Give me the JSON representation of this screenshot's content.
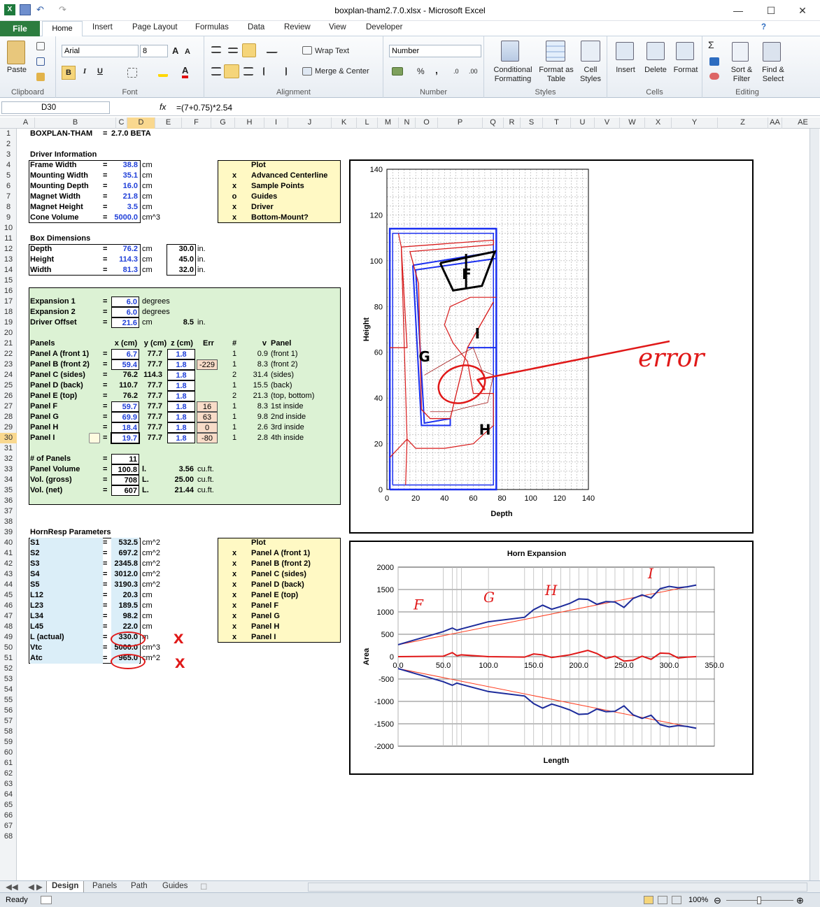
{
  "window": {
    "title": "boxplan-tham2.7.0.xlsx  -  Microsoft Excel"
  },
  "tabs": [
    "File",
    "Home",
    "Insert",
    "Page Layout",
    "Formulas",
    "Data",
    "Review",
    "View",
    "Developer"
  ],
  "ribbon": {
    "clipboard": {
      "paste": "Paste",
      "label": "Clipboard"
    },
    "font": {
      "name": "Arial",
      "size": "8",
      "label": "Font",
      "bold": "B",
      "italic": "I",
      "underline": "U"
    },
    "alignment": {
      "wrap": "Wrap Text",
      "merge": "Merge & Center",
      "label": "Alignment"
    },
    "number": {
      "format": "Number",
      "label": "Number",
      "percent": "%",
      "comma": ","
    },
    "styles": {
      "conditional": "Conditional Formatting",
      "table": "Format as Table",
      "cell": "Cell Styles",
      "label": "Styles"
    },
    "cells": {
      "insert": "Insert",
      "delete": "Delete",
      "format": "Format",
      "label": "Cells"
    },
    "editing": {
      "sort": "Sort & Filter",
      "find": "Find & Select",
      "label": "Editing"
    }
  },
  "formula_bar": {
    "name_box": "D30",
    "fx": "fx",
    "formula": "=(7+0.75)*2.54"
  },
  "columns": [
    "A",
    "B",
    "C",
    "D",
    "E",
    "F",
    "G",
    "H",
    "I",
    "J",
    "K",
    "L",
    "M",
    "N",
    "O",
    "P",
    "Q",
    "R",
    "S",
    "T",
    "U",
    "V",
    "W",
    "X",
    "Y",
    "Z",
    "AA",
    "AE"
  ],
  "sheet": {
    "title": "BOXPLAN-THAM",
    "eq": "=",
    "version": "2.7.0 BETA",
    "driver_header": "Driver Information",
    "driver": [
      {
        "label": "Frame Width",
        "value": "38.8",
        "unit": "cm"
      },
      {
        "label": "Mounting Width",
        "value": "35.1",
        "unit": "cm"
      },
      {
        "label": "Mounting Depth",
        "value": "16.0",
        "unit": "cm"
      },
      {
        "label": "Magnet Width",
        "value": "21.8",
        "unit": "cm"
      },
      {
        "label": "Magnet Height",
        "value": "3.5",
        "unit": "cm"
      },
      {
        "label": "Cone Volume",
        "value": "5000.0",
        "unit": "cm^3"
      }
    ],
    "plot1_header": "Plot",
    "plot1": [
      {
        "mark": "x",
        "label": "Advanced Centerline"
      },
      {
        "mark": "x",
        "label": "Sample Points"
      },
      {
        "mark": "o",
        "label": "Guides"
      },
      {
        "mark": "x",
        "label": "Driver"
      },
      {
        "mark": "x",
        "label": "Bottom-Mount?"
      }
    ],
    "box_header": "Box Dimensions",
    "box": [
      {
        "label": "Depth",
        "value": "76.2",
        "unit": "cm",
        "in": "30.0",
        "in_unit": "in."
      },
      {
        "label": "Height",
        "value": "114.3",
        "unit": "cm",
        "in": "45.0",
        "in_unit": "in."
      },
      {
        "label": "Width",
        "value": "81.3",
        "unit": "cm",
        "in": "32.0",
        "in_unit": "in."
      }
    ],
    "expansion": [
      {
        "label": "Expansion 1",
        "value": "6.0",
        "unit": "degrees"
      },
      {
        "label": "Expansion 2",
        "value": "6.0",
        "unit": "degrees"
      },
      {
        "label": "Driver Offset",
        "value": "21.6",
        "unit": "cm",
        "extra": "8.5",
        "extra_unit": "in."
      }
    ],
    "panel_headers": {
      "panels": "Panels",
      "x": "x (cm)",
      "y": "y (cm)",
      "z": "z (cm)",
      "err": "Err",
      "num": "#",
      "v": "v",
      "panel": "Panel"
    },
    "panels": [
      {
        "label": "Panel A (front 1)",
        "x": "6.7",
        "y": "77.7",
        "z": "1.8",
        "err": "",
        "num": "1",
        "v": "0.9",
        "name": "(front 1)",
        "xin": true
      },
      {
        "label": "Panel B (front 2)",
        "x": "59.4",
        "y": "77.7",
        "z": "1.8",
        "err": "-229",
        "num": "1",
        "v": "8.3",
        "name": "(front 2)",
        "xin": true
      },
      {
        "label": "Panel C (sides)",
        "x": "76.2",
        "y": "114.3",
        "z": "1.8",
        "err": "",
        "num": "2",
        "v": "31.4",
        "name": "(sides)",
        "xin": false
      },
      {
        "label": "Panel D (back)",
        "x": "110.7",
        "y": "77.7",
        "z": "1.8",
        "err": "",
        "num": "1",
        "v": "15.5",
        "name": "(back)",
        "xin": false
      },
      {
        "label": "Panel E (top)",
        "x": "76.2",
        "y": "77.7",
        "z": "1.8",
        "err": "",
        "num": "2",
        "v": "21.3",
        "name": "(top, bottom)",
        "xin": false
      },
      {
        "label": "Panel F",
        "x": "59.7",
        "y": "77.7",
        "z": "1.8",
        "err": "16",
        "num": "1",
        "v": "8.3",
        "name": "1st inside",
        "xin": true
      },
      {
        "label": "Panel G",
        "x": "69.9",
        "y": "77.7",
        "z": "1.8",
        "err": "63",
        "num": "1",
        "v": "9.8",
        "name": "2nd inside",
        "xin": true
      },
      {
        "label": "Panel H",
        "x": "18.4",
        "y": "77.7",
        "z": "1.8",
        "err": "0",
        "num": "1",
        "v": "2.6",
        "name": "3rd inside",
        "xin": true
      },
      {
        "label": "Panel I",
        "x": "19.7",
        "y": "77.7",
        "z": "1.8",
        "err": "-80",
        "num": "1",
        "v": "2.8",
        "name": "4th inside",
        "xin": true
      }
    ],
    "totals": [
      {
        "label": "# of Panels",
        "value": "11",
        "unit": "",
        "extra": "",
        "extra_unit": ""
      },
      {
        "label": "Panel Volume",
        "value": "100.8",
        "unit": "l.",
        "extra": "3.56",
        "extra_unit": "cu.ft."
      },
      {
        "label": "Vol. (gross)",
        "value": "708",
        "unit": "L.",
        "extra": "25.00",
        "extra_unit": "cu.ft."
      },
      {
        "label": "Vol. (net)",
        "value": "607",
        "unit": "L.",
        "extra": "21.44",
        "extra_unit": "cu.ft."
      }
    ],
    "hornresp_header": "HornResp Parameters",
    "hornresp": [
      {
        "label": "S1",
        "value": "532.5",
        "unit": "cm^2"
      },
      {
        "label": "S2",
        "value": "697.2",
        "unit": "cm^2"
      },
      {
        "label": "S3",
        "value": "2345.8",
        "unit": "cm^2"
      },
      {
        "label": "S4",
        "value": "3012.0",
        "unit": "cm^2"
      },
      {
        "label": "S5",
        "value": "3190.3",
        "unit": "cm^2"
      },
      {
        "label": "L12",
        "value": "20.3",
        "unit": "cm"
      },
      {
        "label": "L23",
        "value": "189.5",
        "unit": "cm"
      },
      {
        "label": "L34",
        "value": "98.2",
        "unit": "cm"
      },
      {
        "label": "L45",
        "value": "22.0",
        "unit": "cm"
      },
      {
        "label": "L (actual)",
        "value": "330.0",
        "unit": "m"
      },
      {
        "label": "Vtc",
        "value": "5000.0",
        "unit": "cm^3"
      },
      {
        "label": "Atc",
        "value": "965.0",
        "unit": "cm^2"
      }
    ],
    "plot2_header": "Plot",
    "plot2": [
      {
        "mark": "x",
        "label": "Panel A (front 1)"
      },
      {
        "mark": "x",
        "label": "Panel B (front 2)"
      },
      {
        "mark": "x",
        "label": "Panel C (sides)"
      },
      {
        "mark": "x",
        "label": "Panel D (back)"
      },
      {
        "mark": "x",
        "label": "Panel E (top)"
      },
      {
        "mark": "x",
        "label": "Panel F"
      },
      {
        "mark": "x",
        "label": "Panel G"
      },
      {
        "mark": "x",
        "label": "Panel H"
      },
      {
        "mark": "x",
        "label": "Panel I"
      }
    ],
    "annotation": "error",
    "annotation_x": "x"
  },
  "chart_data": [
    {
      "type": "line",
      "title": "",
      "xlabel": "Depth",
      "ylabel": "Height",
      "xlim": [
        0,
        140
      ],
      "ylim": [
        0,
        140
      ],
      "xticks": [
        "0",
        "20",
        "40",
        "60",
        "80",
        "100",
        "120",
        "140"
      ],
      "yticks": [
        "0",
        "20",
        "40",
        "60",
        "80",
        "100",
        "120",
        "140"
      ],
      "grid": true,
      "labels": [
        "F",
        "G",
        "H",
        "I"
      ]
    },
    {
      "type": "line",
      "title": "Horn Expansion",
      "xlabel": "Length",
      "ylabel": "Area",
      "xlim": [
        0,
        350
      ],
      "ylim": [
        -2000,
        2000
      ],
      "xticks": [
        "0.0",
        "50.0",
        "100.0",
        "150.0",
        "200.0",
        "250.0",
        "300.0",
        "350.0"
      ],
      "yticks": [
        "2000",
        "1500",
        "1000",
        "500",
        "0",
        "-500",
        "-1000",
        "-1500",
        "-2000"
      ],
      "grid": true,
      "series": [
        {
          "x": [
            0,
            50,
            60,
            65,
            70,
            100,
            140,
            150,
            160,
            170,
            180,
            190,
            200,
            210,
            220,
            230,
            240,
            250,
            260,
            270,
            280,
            290,
            300,
            310,
            320,
            330
          ],
          "values": [
            266,
            560,
            640,
            590,
            620,
            780,
            880,
            1050,
            1150,
            1060,
            1120,
            1190,
            1290,
            1280,
            1170,
            1230,
            1220,
            1100,
            1300,
            1380,
            1310,
            1520,
            1570,
            1540,
            1560,
            1600
          ]
        },
        {
          "x": [
            0,
            50,
            60,
            65,
            70,
            100,
            140,
            150,
            160,
            170,
            180,
            190,
            200,
            210,
            220,
            230,
            240,
            250,
            260,
            270,
            280,
            290,
            300,
            310,
            320,
            330
          ],
          "values": [
            -266,
            -560,
            -640,
            -590,
            -620,
            -780,
            -880,
            -1050,
            -1150,
            -1060,
            -1120,
            -1190,
            -1290,
            -1280,
            -1170,
            -1230,
            -1220,
            -1100,
            -1300,
            -1380,
            -1310,
            -1520,
            -1570,
            -1540,
            -1560,
            -1600
          ]
        },
        {
          "x": [
            0,
            50,
            60,
            65,
            70,
            100,
            140,
            150,
            160,
            170,
            180,
            190,
            200,
            210,
            220,
            230,
            240,
            250,
            260,
            270,
            280,
            290,
            300,
            310,
            320,
            330
          ],
          "values": [
            0,
            10,
            90,
            20,
            40,
            0,
            -10,
            60,
            40,
            -20,
            10,
            40,
            90,
            140,
            70,
            -40,
            10,
            -100,
            -80,
            10,
            -60,
            80,
            70,
            -30,
            -10,
            0
          ]
        }
      ],
      "trend": [
        [
          0,
          266
        ],
        [
          330,
          1600
        ]
      ]
    }
  ],
  "sheet_tabs": [
    "Design",
    "Panels",
    "Path",
    "Guides"
  ],
  "status": {
    "ready": "Ready",
    "zoom": "100%"
  }
}
